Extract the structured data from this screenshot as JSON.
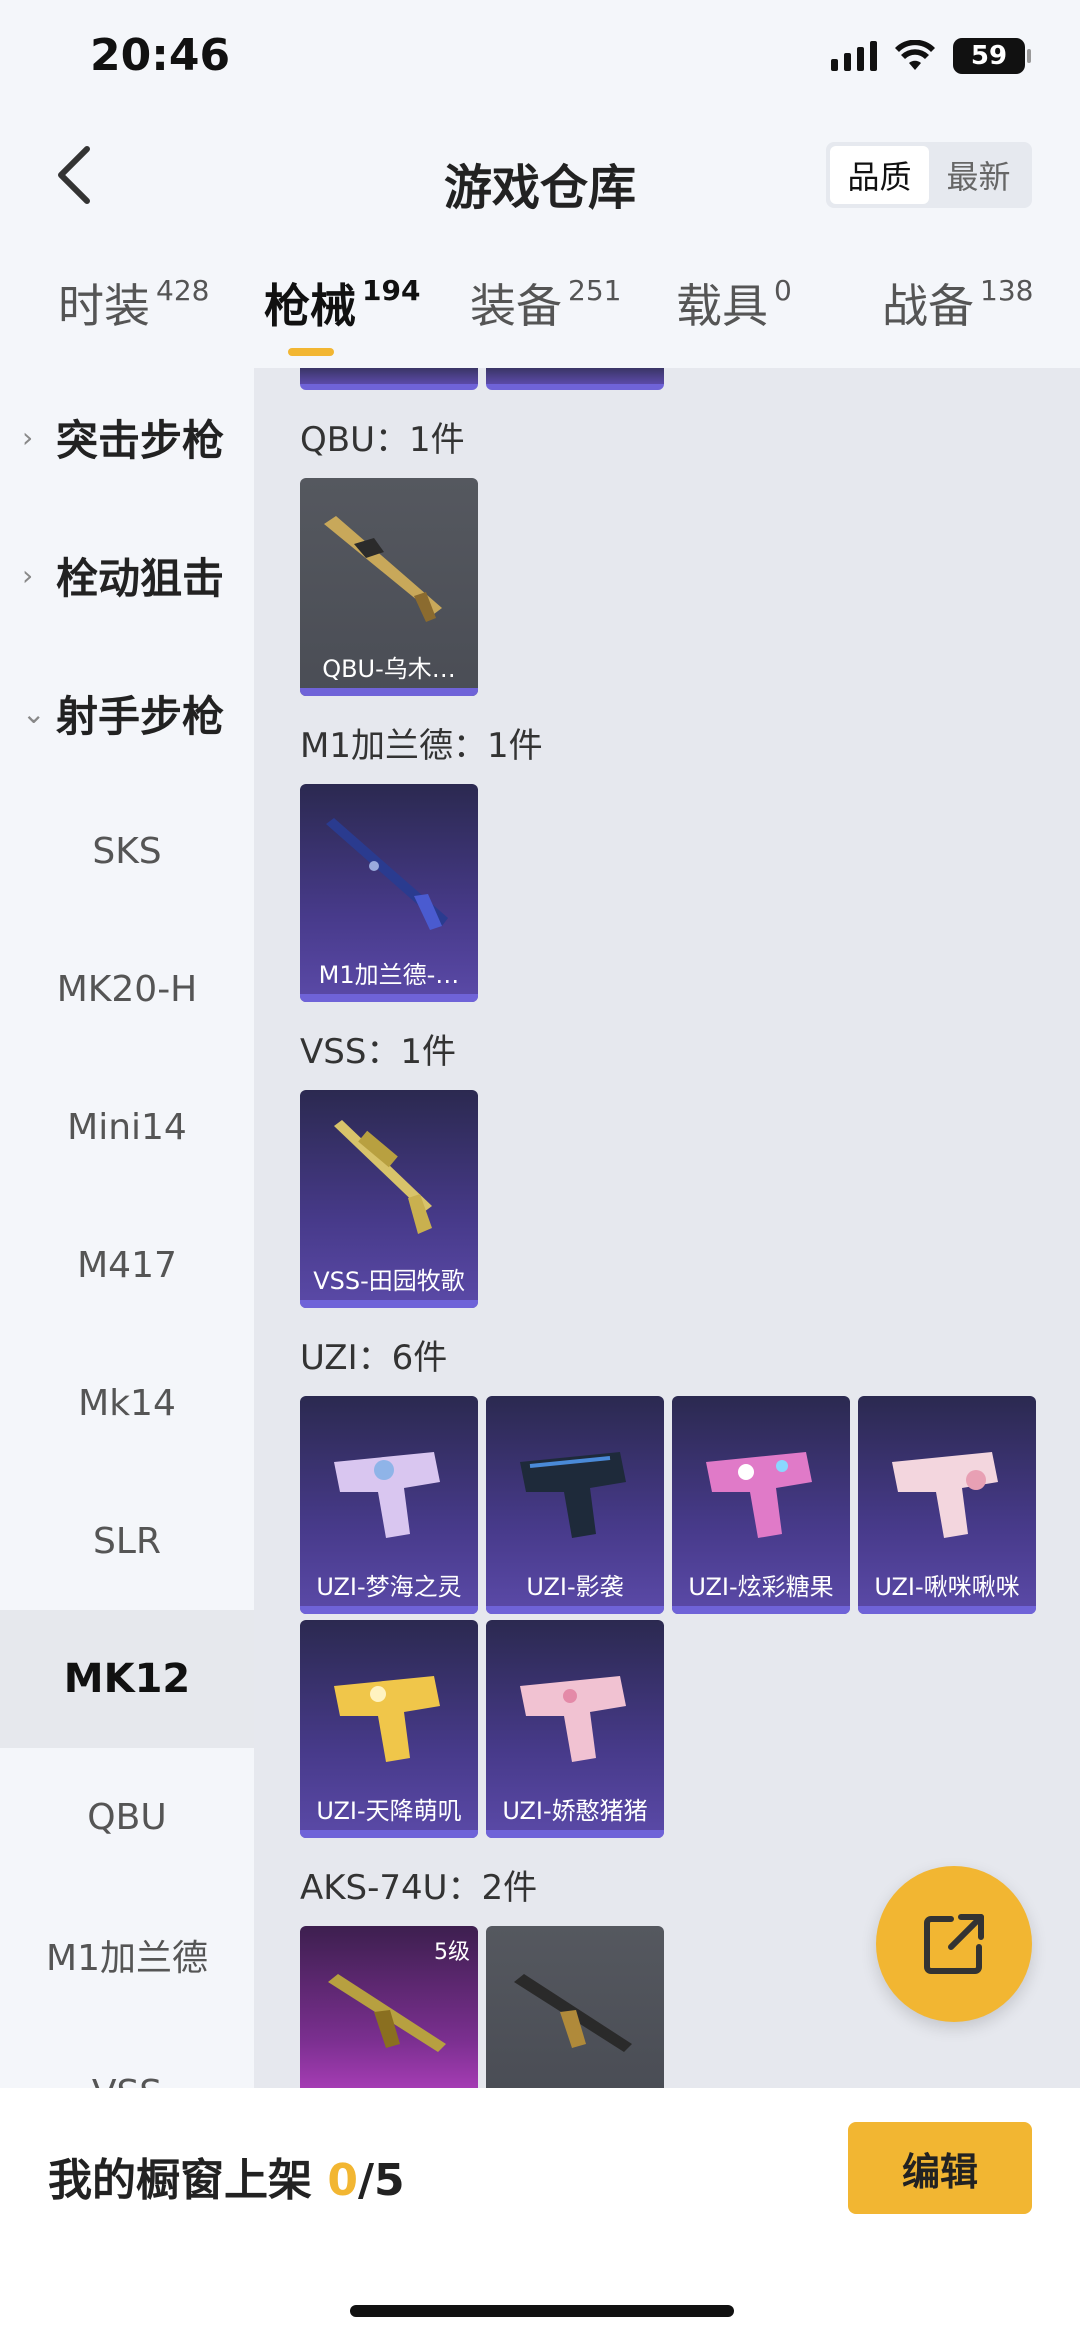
{
  "status": {
    "time": "20:46",
    "battery": "59"
  },
  "header": {
    "title": "游戏仓库",
    "sort_options": [
      "品质",
      "最新"
    ],
    "sort_active": "品质"
  },
  "tabs": [
    {
      "label": "时装",
      "count": "428"
    },
    {
      "label": "枪械",
      "count": "194"
    },
    {
      "label": "装备",
      "count": "251"
    },
    {
      "label": "载具",
      "count": "0"
    },
    {
      "label": "战备",
      "count": "138"
    }
  ],
  "sidebar": {
    "groups": [
      "突击步枪",
      "栓动狙击",
      "射手步枪"
    ],
    "items": [
      "SKS",
      "MK20-H",
      "Mini14",
      "M417",
      "Mk14",
      "SLR",
      "MK12",
      "QBU",
      "M1加兰德",
      "VSS"
    ],
    "active": "MK12"
  },
  "sections": [
    {
      "title": "QBU：1件",
      "items": [
        {
          "name": "QBU-乌木…",
          "icon": "rifle-icon",
          "rarity": "grey"
        }
      ]
    },
    {
      "title": "M1加兰德：1件",
      "items": [
        {
          "name": "M1加兰德-…",
          "icon": "rifle-icon",
          "rarity": "purple"
        }
      ]
    },
    {
      "title": "VSS：1件",
      "items": [
        {
          "name": "VSS-田园牧歌",
          "icon": "sniper-icon",
          "rarity": "purple"
        }
      ]
    },
    {
      "title": "UZI：6件",
      "items": [
        {
          "name": "UZI-梦海之灵",
          "icon": "smg-icon",
          "rarity": "purple"
        },
        {
          "name": "UZI-影袭",
          "icon": "smg-icon",
          "rarity": "purple"
        },
        {
          "name": "UZI-炫彩糖果",
          "icon": "smg-icon",
          "rarity": "purple"
        },
        {
          "name": "UZI-啾咪啾咪",
          "icon": "smg-icon",
          "rarity": "purple"
        },
        {
          "name": "UZI-天降萌叽",
          "icon": "smg-icon",
          "rarity": "purple"
        },
        {
          "name": "UZI-娇憨猪猪",
          "icon": "smg-icon",
          "rarity": "purple"
        }
      ]
    },
    {
      "title": "AKS-74U：2件",
      "items": [
        {
          "name": "",
          "level": "5级",
          "icon": "smg-icon",
          "rarity": "magenta"
        },
        {
          "name": "",
          "icon": "smg-icon",
          "rarity": "grey"
        }
      ]
    }
  ],
  "bottom": {
    "label": "我的橱窗上架",
    "current": "0",
    "total": "/5",
    "edit_label": "编辑"
  },
  "colors": {
    "accent": "#f2b632",
    "purple_base": "#6f63d8"
  }
}
